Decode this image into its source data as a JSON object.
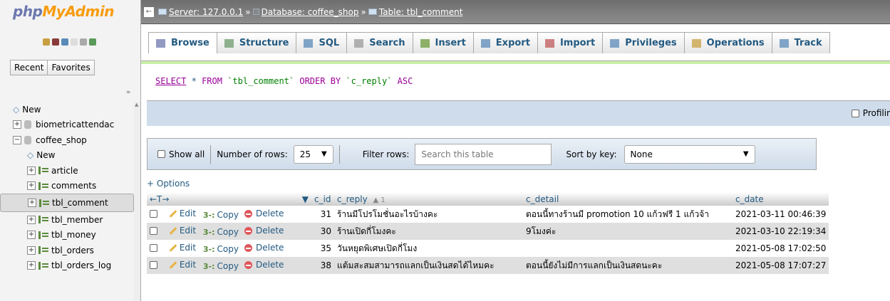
{
  "app": {
    "logo_php": "php",
    "logo_my": "MyAdmin"
  },
  "nav": {
    "tabs": [
      "Recent",
      "Favorites"
    ],
    "tree": [
      {
        "label": "New",
        "type": "new",
        "level": 0
      },
      {
        "label": "biometricattendac",
        "type": "db",
        "level": 0,
        "expander": "+"
      },
      {
        "label": "coffee_shop",
        "type": "db",
        "level": 0,
        "expander": "−"
      },
      {
        "label": "New",
        "type": "new",
        "level": 1
      },
      {
        "label": "article",
        "type": "table",
        "level": 1,
        "expander": "+"
      },
      {
        "label": "comments",
        "type": "table",
        "level": 1,
        "expander": "+"
      },
      {
        "label": "tbl_comment",
        "type": "table",
        "level": 1,
        "expander": "+",
        "selected": true
      },
      {
        "label": "tbl_member",
        "type": "table",
        "level": 1,
        "expander": "+"
      },
      {
        "label": "tbl_money",
        "type": "table",
        "level": 1,
        "expander": "+"
      },
      {
        "label": "tbl_orders",
        "type": "table",
        "level": 1,
        "expander": "+"
      },
      {
        "label": "tbl_orders_log",
        "type": "table",
        "level": 1,
        "expander": "+"
      }
    ]
  },
  "breadcrumb": {
    "server": "Server: 127.0.0.1",
    "database": "Database: coffee_shop",
    "table": "Table: tbl_comment",
    "separator": "»"
  },
  "tabs": [
    {
      "label": "Browse",
      "icon": "browse-icon",
      "active": true
    },
    {
      "label": "Structure",
      "icon": "structure-icon"
    },
    {
      "label": "SQL",
      "icon": "sql-icon"
    },
    {
      "label": "Search",
      "icon": "search-icon"
    },
    {
      "label": "Insert",
      "icon": "insert-icon"
    },
    {
      "label": "Export",
      "icon": "export-icon"
    },
    {
      "label": "Import",
      "icon": "import-icon"
    },
    {
      "label": "Privileges",
      "icon": "privileges-icon"
    },
    {
      "label": "Operations",
      "icon": "operations-icon"
    },
    {
      "label": "Track",
      "icon": "tracking-icon"
    }
  ],
  "sql": {
    "select": "SELECT",
    "star": "*",
    "from": "FROM",
    "table": "`tbl_comment`",
    "order_by": "ORDER BY",
    "column": "`c_reply`",
    "asc": "ASC"
  },
  "profiling_label": "Profilir",
  "controls": {
    "show_all": "Show all",
    "number_of_rows_label": "Number of rows:",
    "number_of_rows_value": "25",
    "filter_rows_label": "Filter rows:",
    "filter_placeholder": "Search this table",
    "sort_by_key_label": "Sort by key:",
    "sort_by_key_value": "None"
  },
  "options_link": "+ Options",
  "table": {
    "headers": {
      "arrows": "←T→",
      "c_id": "c_id",
      "c_reply": "c_reply",
      "c_reply_sort": "▲ 1",
      "c_detail": "c_detail",
      "c_date": "c_date"
    },
    "action_labels": {
      "edit": "Edit",
      "copy": "Copy",
      "delete": "Delete"
    },
    "rows": [
      {
        "c_id": "31",
        "c_reply": "ร้านมีโปรโมชั่นอะไรบ้างคะ",
        "c_detail": "ตอนนี้ทางร้านมี promotion 10 แก้วฟรี 1 แก้วจ้า",
        "c_date": "2021-03-11 00:46:39"
      },
      {
        "c_id": "30",
        "c_reply": "ร้านเปิดกี่โมงคะ",
        "c_detail": "9โมงค่ะ",
        "c_date": "2021-03-10 22:19:34"
      },
      {
        "c_id": "35",
        "c_reply": "วันหยุดพิเศษเปิดกี่โมง",
        "c_detail": "",
        "c_date": "2021-05-08 17:02:50"
      },
      {
        "c_id": "38",
        "c_reply": "แต้มสะสมสามารถแลกเป็นเงินสดได้ไหมคะ",
        "c_detail": "ตอนนี้ยังไม่มีการแลกเป็นเงินสดนะคะ",
        "c_date": "2021-05-08 17:07:27"
      }
    ]
  },
  "colors": {
    "link": "#235a81",
    "accent_green": "#c9f0a6",
    "bar_blue": "#cfdceb"
  }
}
